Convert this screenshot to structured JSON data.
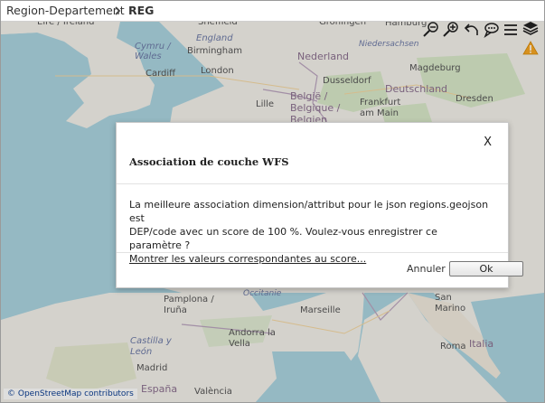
{
  "breadcrumb": {
    "parent": "Region-Departement",
    "current": "REG"
  },
  "map": {
    "labels": {
      "eire": "Éire / Ireland",
      "sheffield": "Sheffield",
      "england": "England",
      "cymru": "Cymru / Wales",
      "birmingham": "Birmingham",
      "cardiff": "Cardiff",
      "london": "London",
      "groningen": "Groningen",
      "hamburg": "Hamburg",
      "niedersachsen": "Niedersachsen",
      "nederland": "Nederland",
      "magdeburg": "Magdeburg",
      "dusseldorf": "Dusseldorf",
      "deutschland": "Deutschland",
      "lille": "Lille",
      "belgie": "België / Belgique / Belgien",
      "frankfurt": "Frankfurt am Main",
      "dresden": "Dresden",
      "pamplona": "Pamplona / Iruña",
      "occitanie": "Occitanie",
      "marseille": "Marseille",
      "andorra": "Andorra la Vella",
      "castilla": "Castilla y León",
      "madrid": "Madrid",
      "espana": "España",
      "valencia": "València",
      "sanmarino": "San Marino",
      "italia": "Italia",
      "roma": "Roma"
    },
    "attribution": "© OpenStreetMap contributors"
  },
  "toolbar": {
    "icons": [
      "zoom-out-icon",
      "zoom-in-icon",
      "undo-icon",
      "comment-icon",
      "menu-icon",
      "layers-icon"
    ]
  },
  "dialog": {
    "close": "X",
    "title": "Association de couche WFS",
    "body_line1": "La meilleure association dimension/attribut pour le json regions.geojson est",
    "body_line2": "DEP/code avec un score de 100 %. Voulez-vous enregistrer ce paramètre ?",
    "link": "Montrer les valeurs correspondantes au score...",
    "cancel": "Annuler",
    "ok": "Ok"
  }
}
